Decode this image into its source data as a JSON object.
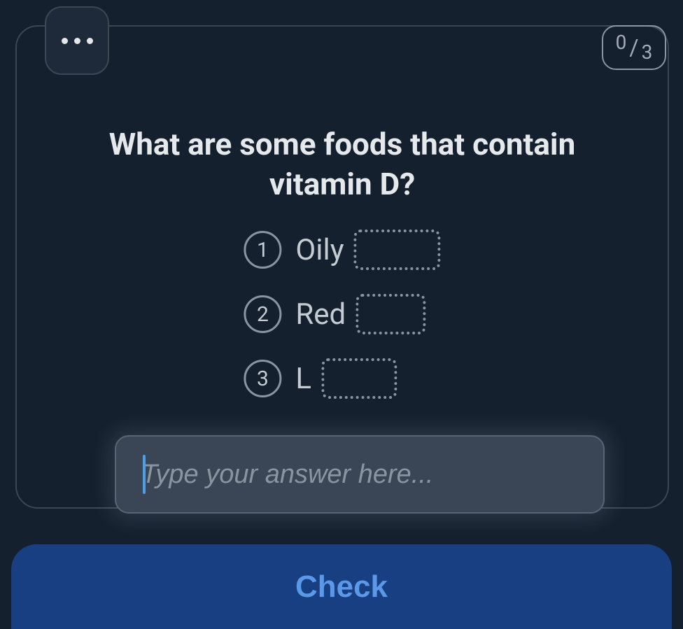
{
  "score": {
    "current": "0",
    "slash": "/",
    "total": "3"
  },
  "question": "What are some foods that contain vitamin D?",
  "answers": [
    {
      "number": "1",
      "prefix": "Oily"
    },
    {
      "number": "2",
      "prefix": "Red"
    },
    {
      "number": "3",
      "prefix": "L"
    }
  ],
  "input": {
    "placeholder": "Type your answer here...",
    "value": ""
  },
  "checkButton": "Check"
}
